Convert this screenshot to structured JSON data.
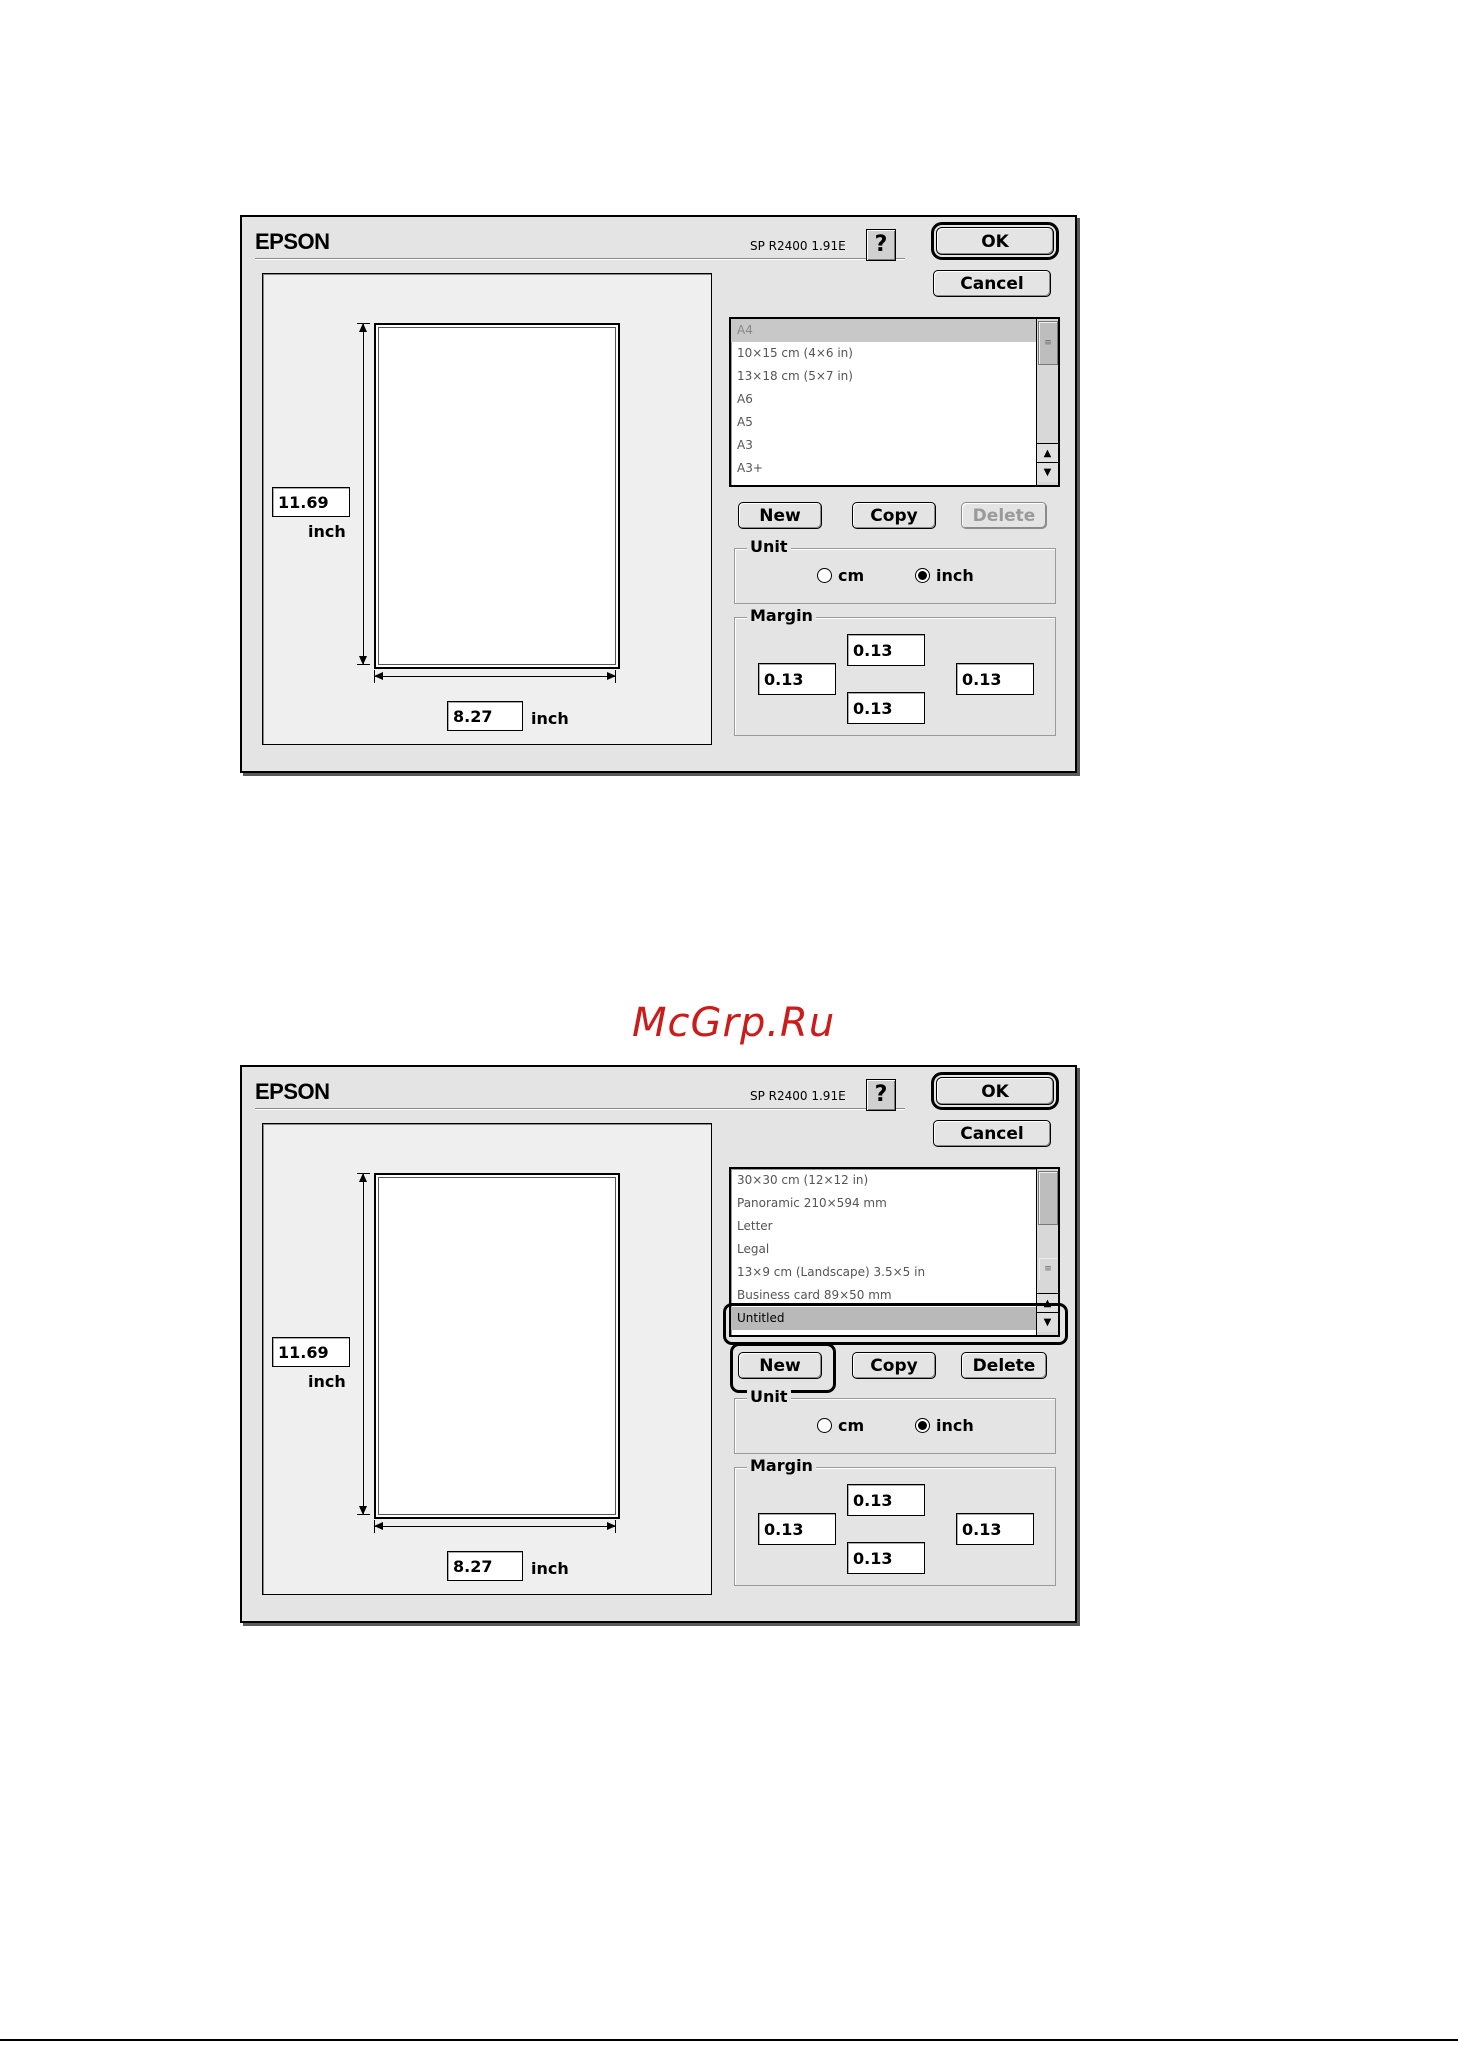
{
  "watermark": "McGrp.Ru",
  "dialogs": [
    {
      "brand": "EPSON",
      "version": "SP R2400 1.91E",
      "help_label": "?",
      "ok_label": "OK",
      "cancel_label": "Cancel",
      "paper_height": "11.69",
      "paper_width": "8.27",
      "height_unit": "inch",
      "width_unit": "inch",
      "paper_list": [
        {
          "label": "A4",
          "state": "selected"
        },
        {
          "label": "10×15 cm (4×6 in)",
          "state": ""
        },
        {
          "label": "13×18 cm (5×7 in)",
          "state": ""
        },
        {
          "label": "A6",
          "state": ""
        },
        {
          "label": "A5",
          "state": ""
        },
        {
          "label": "A3",
          "state": ""
        },
        {
          "label": "A3+",
          "state": ""
        }
      ],
      "new_label": "New",
      "copy_label": "Copy",
      "delete_label": "Delete",
      "delete_enabled": false,
      "unit": {
        "title": "Unit",
        "cm_label": "cm",
        "inch_label": "inch",
        "selected": "inch"
      },
      "margin": {
        "title": "Margin",
        "top": "0.13",
        "left": "0.13",
        "right": "0.13",
        "bottom": "0.13"
      }
    },
    {
      "brand": "EPSON",
      "version": "SP R2400 1.91E",
      "help_label": "?",
      "ok_label": "OK",
      "cancel_label": "Cancel",
      "paper_height": "11.69",
      "paper_width": "8.27",
      "height_unit": "inch",
      "width_unit": "inch",
      "paper_list": [
        {
          "label": "30×30 cm (12×12 in)",
          "state": ""
        },
        {
          "label": "Panoramic 210×594 mm",
          "state": ""
        },
        {
          "label": "Letter",
          "state": ""
        },
        {
          "label": "Legal",
          "state": ""
        },
        {
          "label": "13×9 cm (Landscape) 3.5×5 in",
          "state": ""
        },
        {
          "label": "Business card 89×50 mm",
          "state": ""
        },
        {
          "label": "Untitled",
          "state": "highlighted"
        }
      ],
      "new_label": "New",
      "copy_label": "Copy",
      "delete_label": "Delete",
      "delete_enabled": true,
      "unit": {
        "title": "Unit",
        "cm_label": "cm",
        "inch_label": "inch",
        "selected": "inch"
      },
      "margin": {
        "title": "Margin",
        "top": "0.13",
        "left": "0.13",
        "right": "0.13",
        "bottom": "0.13"
      }
    }
  ]
}
